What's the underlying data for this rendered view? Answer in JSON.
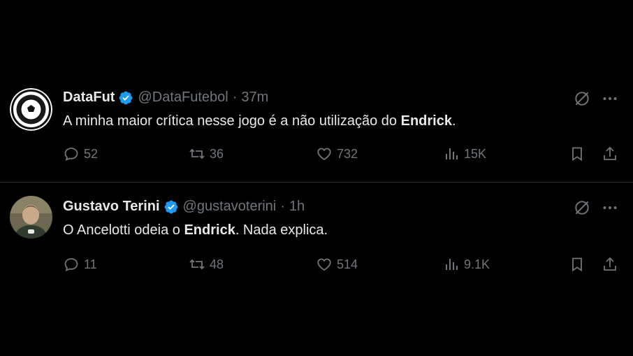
{
  "tweets": [
    {
      "name": "DataFut",
      "handle": "@DataFutebol",
      "separator": "·",
      "time": "37m",
      "text_before": "A minha maior crítica nesse jogo é a não utilização do ",
      "text_bold": "Endrick",
      "text_after": ".",
      "replies": "52",
      "retweets": "36",
      "likes": "732",
      "views": "15K",
      "avatar_icon": "soccer-ball-logo"
    },
    {
      "name": "Gustavo Terini",
      "handle": "@gustavoterini",
      "separator": "·",
      "time": "1h",
      "text_before": "O Ancelotti odeia o ",
      "text_bold": "Endrick",
      "text_after": ". Nada explica.",
      "replies": "11",
      "retweets": "48",
      "likes": "514",
      "views": "9.1K",
      "avatar_icon": "user-photo"
    }
  ],
  "colors": {
    "background": "#000000",
    "text": "#e7e9ea",
    "muted": "#71767b",
    "verified": "#1d9bf0",
    "divider": "#2f3336"
  }
}
